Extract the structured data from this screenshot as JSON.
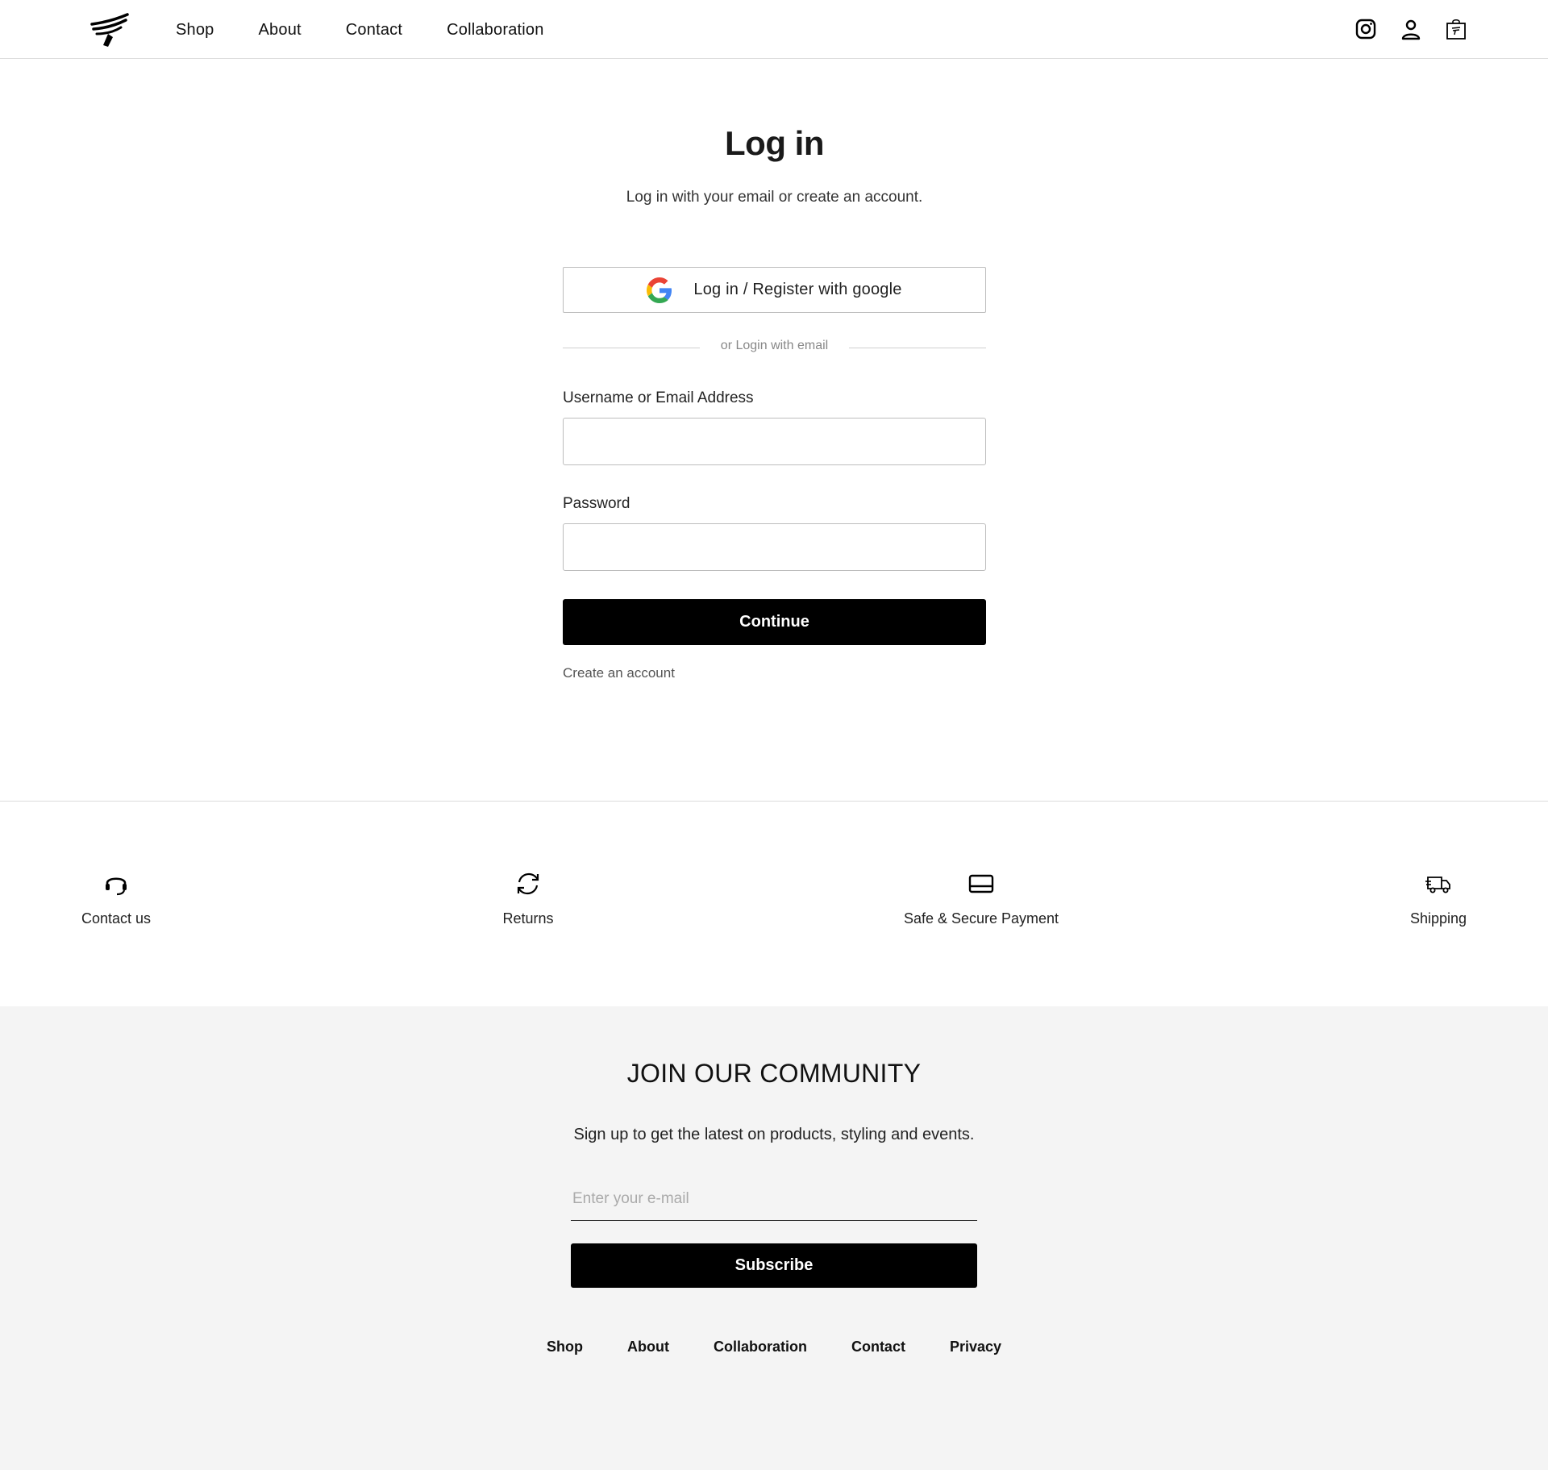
{
  "header": {
    "nav": [
      "Shop",
      "About",
      "Contact",
      "Collaboration"
    ],
    "icons": [
      "instagram-icon",
      "user-icon",
      "shopping-bag-icon"
    ]
  },
  "login": {
    "title": "Log in",
    "subtitle": "Log in with your email or create an account.",
    "google_button": "Log in / Register with google",
    "divider_text": "or Login with email",
    "username_label": "Username or Email Address",
    "username_value": "",
    "password_label": "Password",
    "password_value": "",
    "continue_button": "Continue",
    "create_account": "Create an account"
  },
  "features": [
    {
      "label": "Contact us",
      "icon": "headset-icon"
    },
    {
      "label": "Returns",
      "icon": "refresh-icon"
    },
    {
      "label": "Safe & Secure Payment",
      "icon": "credit-card-icon"
    },
    {
      "label": "Shipping",
      "icon": "truck-icon"
    }
  ],
  "community": {
    "title": "JOIN OUR COMMUNITY",
    "subtitle": "Sign up to get the latest on products, styling and events.",
    "email_placeholder": "Enter your e-mail",
    "subscribe_button": "Subscribe"
  },
  "footer_nav": [
    "Shop",
    "About",
    "Collaboration",
    "Contact",
    "Privacy"
  ],
  "colors": {
    "primary_button": "#000000",
    "community_bg": "#f4f4f4",
    "border": "#bdbdbd"
  }
}
